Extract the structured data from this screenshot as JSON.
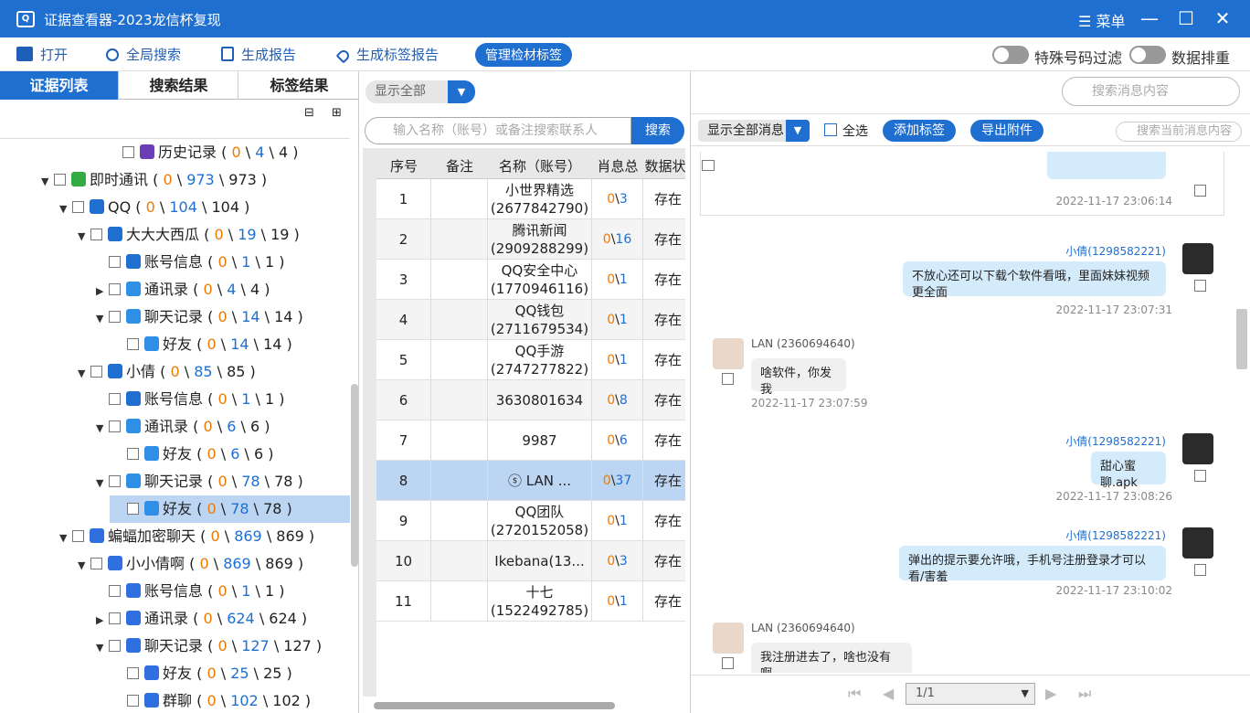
{
  "app": {
    "title": "证据查看器-2023龙信杯复现",
    "menu": "菜单"
  },
  "toolbar": {
    "open": "打开",
    "global_search": "全局搜索",
    "report": "生成报告",
    "tag_report": "生成标签报告",
    "manage_tags": "管理检材标签",
    "filter_special": "特殊号码过滤",
    "dedup": "数据排重"
  },
  "left": {
    "tabs": [
      "证据列表",
      "搜索结果",
      "标签结果"
    ],
    "tree": [
      {
        "label": "历史记录",
        "a": "0",
        "b": "4",
        "c": "4",
        "indent": 120,
        "arrow": "",
        "color": "#6a3fb5"
      },
      {
        "label": "即时通讯",
        "a": "0",
        "b": "973",
        "c": "973",
        "indent": 45,
        "arrow": "▼",
        "color": "#33aa44"
      },
      {
        "label": "QQ",
        "a": "0",
        "b": "104",
        "c": "104",
        "indent": 65,
        "arrow": "▼",
        "color": "#1f6fd0"
      },
      {
        "label": "大大大西瓜",
        "a": "0",
        "b": "19",
        "c": "19",
        "indent": 85,
        "arrow": "▼",
        "color": "#1f6fd0"
      },
      {
        "label": "账号信息",
        "a": "0",
        "b": "1",
        "c": "1",
        "indent": 105,
        "arrow": "",
        "color": "#1f6fd0"
      },
      {
        "label": "通讯录",
        "a": "0",
        "b": "4",
        "c": "4",
        "indent": 105,
        "arrow": "▶",
        "color": "#2f8ee6"
      },
      {
        "label": "聊天记录",
        "a": "0",
        "b": "14",
        "c": "14",
        "indent": 105,
        "arrow": "▼",
        "color": "#2f8ee6"
      },
      {
        "label": "好友",
        "a": "0",
        "b": "14",
        "c": "14",
        "indent": 125,
        "arrow": "",
        "color": "#2f8ee6"
      },
      {
        "label": "小倩",
        "a": "0",
        "b": "85",
        "c": "85",
        "indent": 85,
        "arrow": "▼",
        "color": "#1f6fd0"
      },
      {
        "label": "账号信息",
        "a": "0",
        "b": "1",
        "c": "1",
        "indent": 105,
        "arrow": "",
        "color": "#1f6fd0"
      },
      {
        "label": "通讯录",
        "a": "0",
        "b": "6",
        "c": "6",
        "indent": 105,
        "arrow": "▼",
        "color": "#2f8ee6"
      },
      {
        "label": "好友",
        "a": "0",
        "b": "6",
        "c": "6",
        "indent": 125,
        "arrow": "",
        "color": "#2f8ee6"
      },
      {
        "label": "聊天记录",
        "a": "0",
        "b": "78",
        "c": "78",
        "indent": 105,
        "arrow": "▼",
        "color": "#2f8ee6"
      },
      {
        "label": "好友",
        "a": "0",
        "b": "78",
        "c": "78",
        "indent": 125,
        "arrow": "",
        "color": "#2f8ee6",
        "selected": true
      },
      {
        "label": "蝙蝠加密聊天",
        "a": "0",
        "b": "869",
        "c": "869",
        "indent": 65,
        "arrow": "▼",
        "color": "#2f6fe0"
      },
      {
        "label": "小小倩啊",
        "a": "0",
        "b": "869",
        "c": "869",
        "indent": 85,
        "arrow": "▼",
        "color": "#2f6fe0"
      },
      {
        "label": "账号信息",
        "a": "0",
        "b": "1",
        "c": "1",
        "indent": 105,
        "arrow": "",
        "color": "#2f6fe0"
      },
      {
        "label": "通讯录",
        "a": "0",
        "b": "624",
        "c": "624",
        "indent": 105,
        "arrow": "▶",
        "color": "#2f6fe0"
      },
      {
        "label": "聊天记录",
        "a": "0",
        "b": "127",
        "c": "127",
        "indent": 105,
        "arrow": "▼",
        "color": "#2f6fe0"
      },
      {
        "label": "好友",
        "a": "0",
        "b": "25",
        "c": "25",
        "indent": 125,
        "arrow": "",
        "color": "#2f6fe0"
      },
      {
        "label": "群聊",
        "a": "0",
        "b": "102",
        "c": "102",
        "indent": 125,
        "arrow": "",
        "color": "#2f6fe0"
      }
    ]
  },
  "mid": {
    "filter": "显示全部",
    "search_placeholder": "输入名称（账号）或备注搜索联系人",
    "search_btn": "搜索",
    "headers": [
      "序号",
      "备注",
      "名称（账号）",
      "肖息总数",
      "数据状"
    ],
    "rows": [
      {
        "n": "1",
        "name": "小世界精选\n(2677842790)",
        "a": "0",
        "b": "3",
        "st": "存在"
      },
      {
        "n": "2",
        "name": "腾讯新闻\n(2909288299)",
        "a": "0",
        "b": "16",
        "st": "存在"
      },
      {
        "n": "3",
        "name": "QQ安全中心\n(1770946116)",
        "a": "0",
        "b": "1",
        "st": "存在"
      },
      {
        "n": "4",
        "name": "QQ钱包\n(2711679534)",
        "a": "0",
        "b": "1",
        "st": "存在"
      },
      {
        "n": "5",
        "name": "QQ手游\n(2747277822)",
        "a": "0",
        "b": "1",
        "st": "存在"
      },
      {
        "n": "6",
        "name": "3630801634",
        "a": "0",
        "b": "8",
        "st": "存在"
      },
      {
        "n": "7",
        "name": "9987",
        "a": "0",
        "b": "6",
        "st": "存在"
      },
      {
        "n": "8",
        "name": "ⓢ LAN ...",
        "a": "0",
        "b": "37",
        "st": "存在",
        "selected": true
      },
      {
        "n": "9",
        "name": "QQ团队\n(2720152058)",
        "a": "0",
        "b": "1",
        "st": "存在"
      },
      {
        "n": "10",
        "name": "Ikebana(13...",
        "a": "0",
        "b": "3",
        "st": "存在"
      },
      {
        "n": "11",
        "name": "十七\n(1522492785)",
        "a": "0",
        "b": "1",
        "st": "存在"
      }
    ]
  },
  "right": {
    "search_placeholder": "搜索消息内容",
    "show_all": "显示全部消息",
    "select_all": "全选",
    "add_tag": "添加标签",
    "export": "导出附件",
    "search_current": "搜索当前消息内容",
    "messages": [
      {
        "side": "me",
        "text": "",
        "time": "2022-11-17 23:06:14"
      },
      {
        "side": "me",
        "who": "小倩(1298582221)",
        "text": "不放心还可以下载个软件看哦，里面妹妹视频更全面",
        "time": "2022-11-17 23:07:31"
      },
      {
        "side": "them",
        "who": "LAN (2360694640)",
        "text": "啥软件，你发我",
        "time": "2022-11-17 23:07:59"
      },
      {
        "side": "me",
        "who": "小倩(1298582221)",
        "text": "甜心蜜聊.apk",
        "time": "2022-11-17 23:08:26"
      },
      {
        "side": "me",
        "who": "小倩(1298582221)",
        "text": "弹出的提示要允许哦，手机号注册登录才可以看/害羞",
        "time": "2022-11-17 23:10:02"
      },
      {
        "side": "them",
        "who": "LAN (2360694640)",
        "text": "我注册进去了，啥也没有啊，",
        "time": ""
      }
    ],
    "page": "1/1"
  },
  "colors": {
    "accent": "#1f6fd0",
    "orange": "#ee7a00",
    "selected": "#bcd5f2"
  }
}
